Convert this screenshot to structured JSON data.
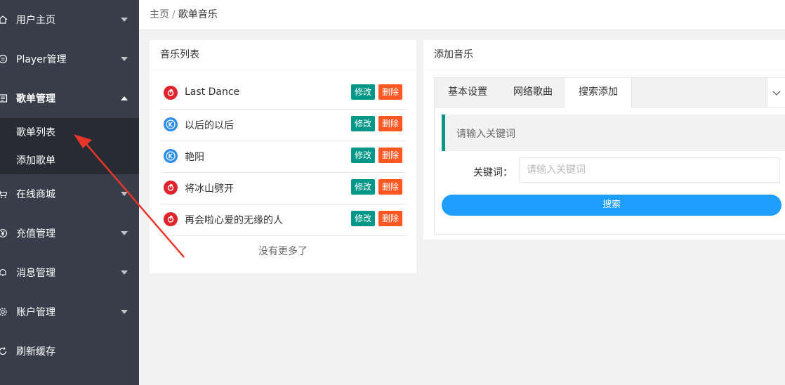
{
  "sidebar": {
    "items": [
      {
        "label": "用户主页",
        "icon": "home-icon"
      },
      {
        "label": "Player管理",
        "icon": "player-icon"
      },
      {
        "label": "歌单管理",
        "icon": "playlist-icon",
        "expanded": true,
        "children": [
          {
            "label": "歌单列表"
          },
          {
            "label": "添加歌单"
          }
        ]
      },
      {
        "label": "在线商城",
        "icon": "cart-icon"
      },
      {
        "label": "充值管理",
        "icon": "yen-icon"
      },
      {
        "label": "消息管理",
        "icon": "bell-icon"
      },
      {
        "label": "账户管理",
        "icon": "gear-icon"
      },
      {
        "label": "刷新缓存",
        "icon": "refresh-icon"
      }
    ]
  },
  "breadcrumb": {
    "home": "主页",
    "separator": "/",
    "current": "歌单音乐"
  },
  "music_list": {
    "title": "音乐列表",
    "items": [
      {
        "title": "Last Dance",
        "source": "netease"
      },
      {
        "title": "以后的以后",
        "source": "kugou"
      },
      {
        "title": "艳阳",
        "source": "kugou"
      },
      {
        "title": "将冰山劈开",
        "source": "netease"
      },
      {
        "title": "再会啦心爱的无缘的人",
        "source": "netease"
      }
    ],
    "edit_label": "修改",
    "delete_label": "删除",
    "no_more": "没有更多了"
  },
  "add_music": {
    "title": "添加音乐",
    "tabs": [
      {
        "label": "基本设置"
      },
      {
        "label": "网络歌曲"
      },
      {
        "label": "搜索添加",
        "active": true
      }
    ],
    "hint": "请输入关键词",
    "keyword_label": "关键词：",
    "keyword_placeholder": "请输入关键词",
    "keyword_value": "",
    "search_label": "搜索"
  },
  "colors": {
    "sidebar_bg": "#393d49",
    "submenu_bg": "#282b33",
    "edit_button": "#009688",
    "delete_button": "#ff5722",
    "search_button": "#1e9fff",
    "annotation_arrow": "#e8352a",
    "netease_badge": "#e0242c",
    "kugou_badge": "#2c8fe5"
  }
}
